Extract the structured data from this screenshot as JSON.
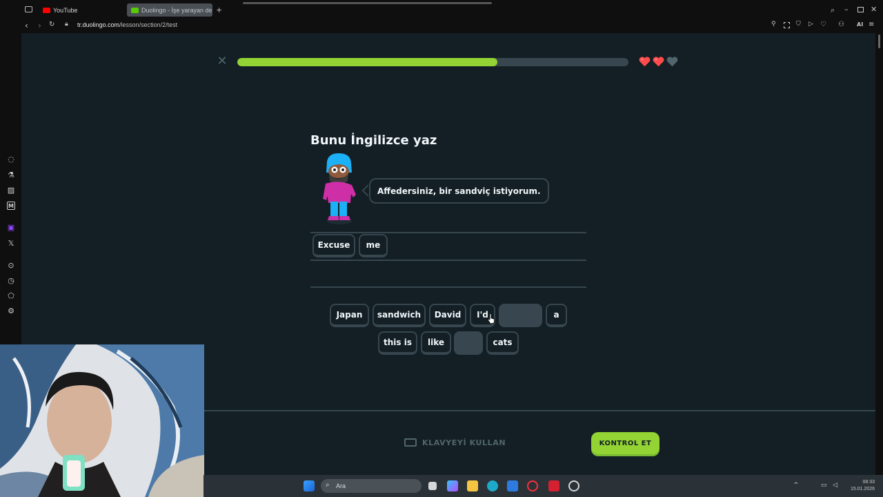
{
  "browser": {
    "tabs": [
      {
        "label": "YouTube",
        "icon": "youtube-icon"
      },
      {
        "label": "Duolingo - İşe yarayan der",
        "icon": "duolingo-icon"
      }
    ],
    "new_tab_icon": "plus-icon",
    "url_host": "tr.duolingo.com",
    "url_path": "/lesson/section/2/test",
    "aria_label": "AI"
  },
  "lesson": {
    "close_icon": "close-icon",
    "progress_fraction": 0.665,
    "hearts": {
      "full": 2,
      "empty": 1
    },
    "title": "Bunu İngilizce yaz",
    "prompt": "Affedersiniz, bir sandviç istiyorum.",
    "answer_words": [
      "Excuse",
      "me"
    ],
    "word_bank_row1": [
      "Japan",
      "sandwich",
      "David",
      "I'd",
      "",
      "a"
    ],
    "word_bank_row2": [
      "this is",
      "like",
      "",
      "cats"
    ],
    "keyboard_label": "KLAVYEYİ KULLAN",
    "check_label": "KONTROL ET"
  },
  "taskbar": {
    "search_placeholder": "Ara",
    "time": "08:33",
    "date": "15.01.2026"
  },
  "colors": {
    "background": "#131f24",
    "progress": "#93d333",
    "border": "#37464f",
    "heart": "#ff4b4b",
    "check_button": "#93d333"
  }
}
